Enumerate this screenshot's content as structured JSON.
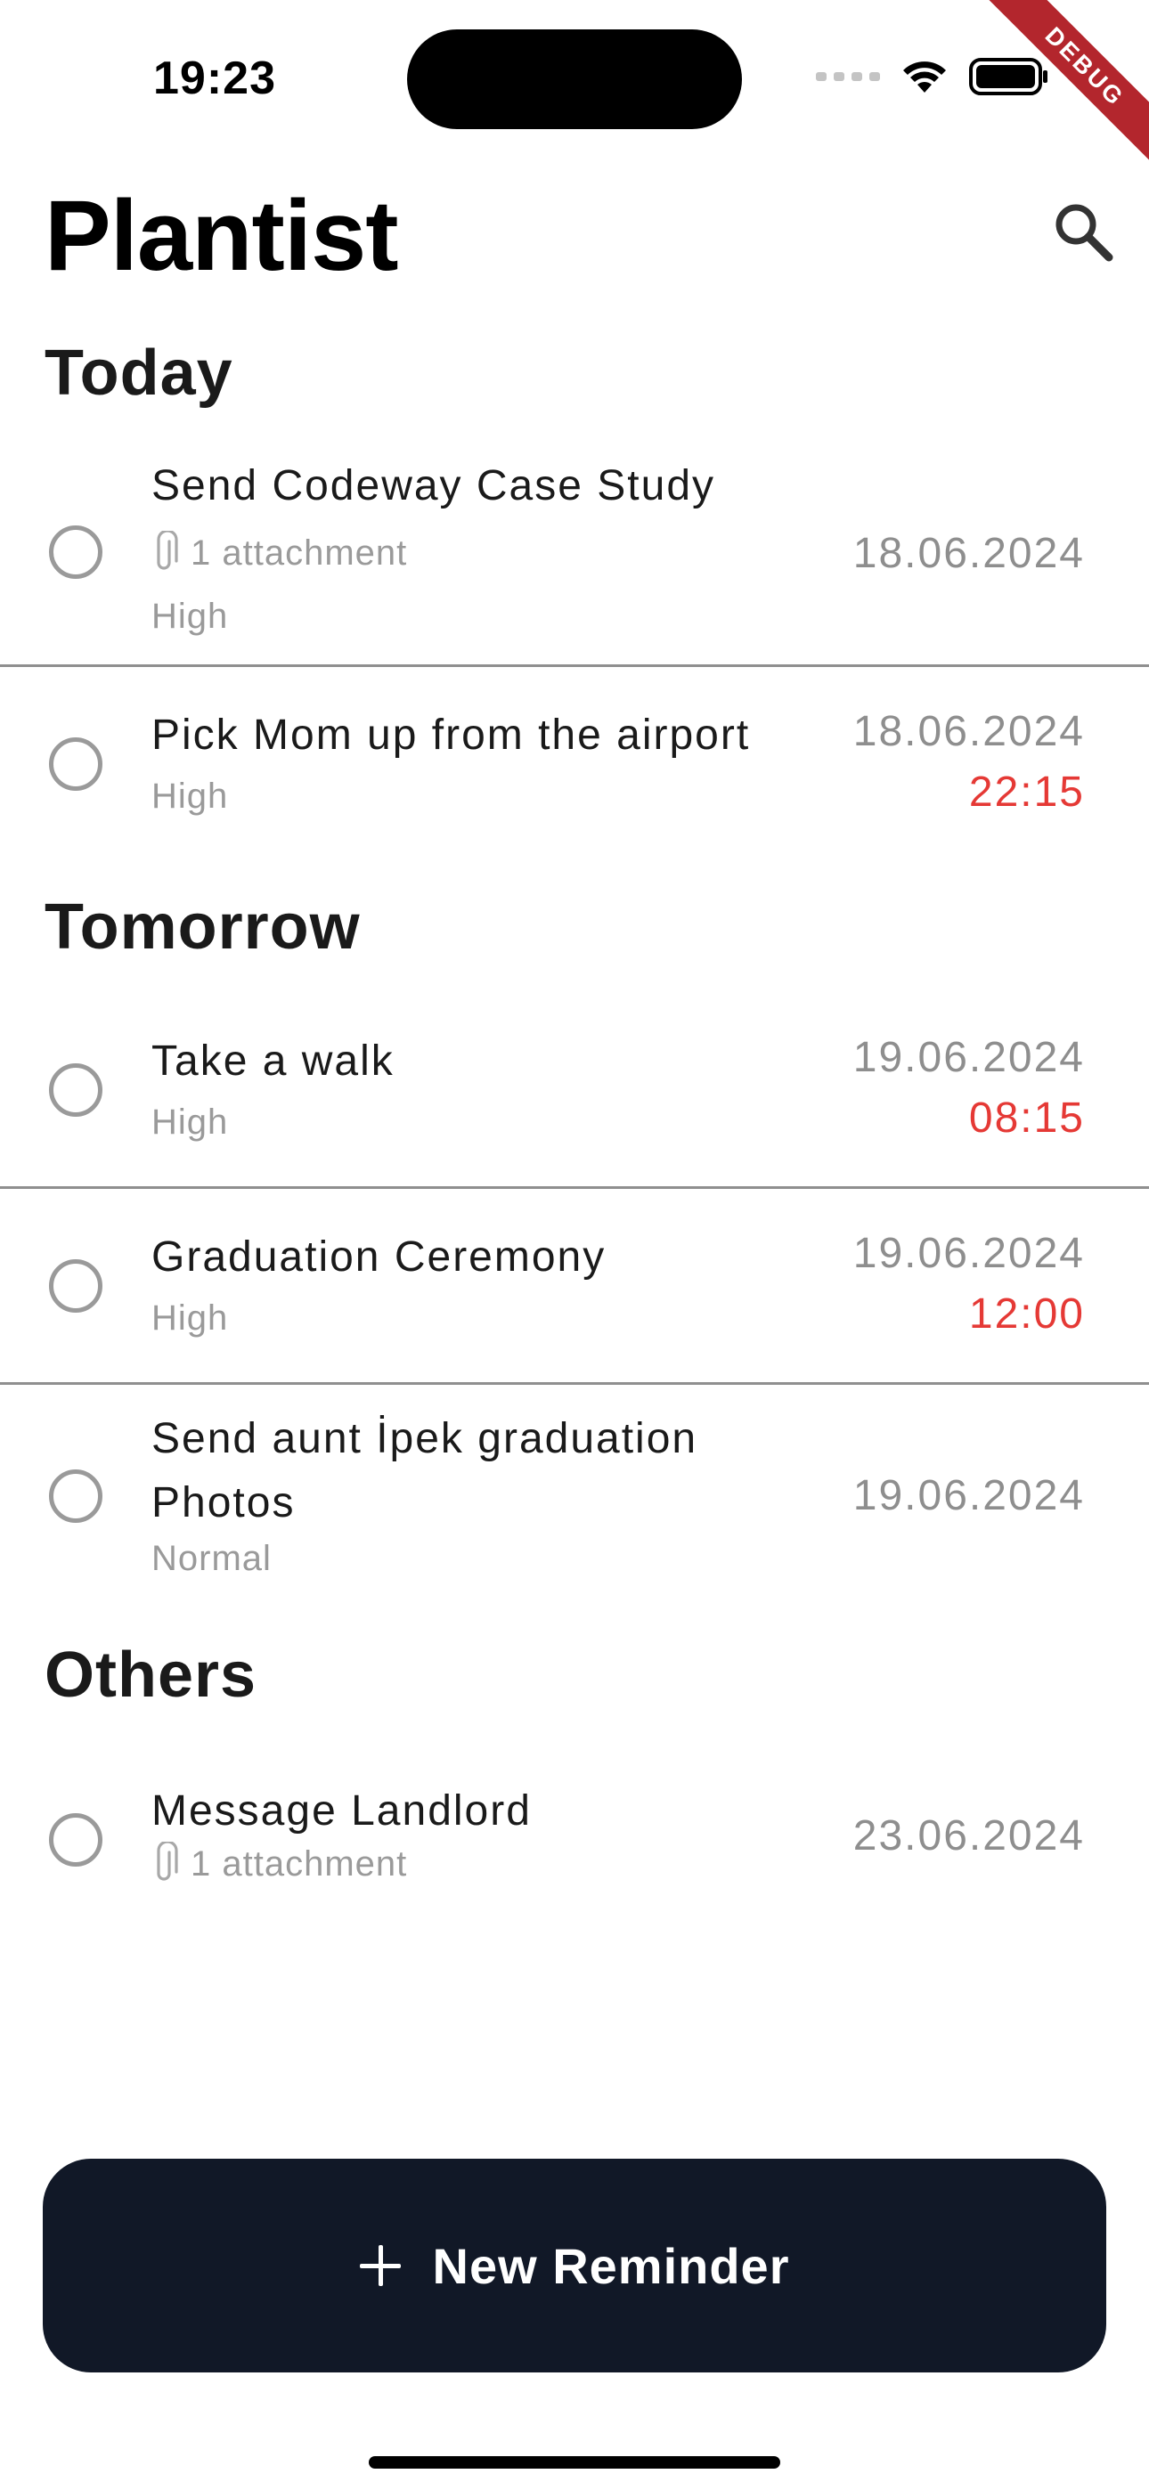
{
  "status_bar": {
    "time": "19:23"
  },
  "debug_banner": "DEBUG",
  "header": {
    "title": "Plantist",
    "search_icon": "search-icon"
  },
  "sections": [
    {
      "title": "Today",
      "items": [
        {
          "title": "Send Codeway Case Study",
          "attachment": "1 attachment",
          "priority": "High",
          "date": "18.06.2024",
          "time": ""
        },
        {
          "title": "Pick Mom up from the airport",
          "attachment": "",
          "priority": "High",
          "date": "18.06.2024",
          "time": "22:15"
        }
      ]
    },
    {
      "title": "Tomorrow",
      "items": [
        {
          "title": "Take a walk",
          "attachment": "",
          "priority": "High",
          "date": "19.06.2024",
          "time": "08:15"
        },
        {
          "title": "Graduation Ceremony",
          "attachment": "",
          "priority": "High",
          "date": "19.06.2024",
          "time": "12:00"
        },
        {
          "title_line1": "Send aunt İpek graduation",
          "title_line2": "Photos",
          "attachment": "",
          "priority": "Normal",
          "date": "19.06.2024",
          "time": ""
        }
      ]
    },
    {
      "title": "Others",
      "items": [
        {
          "title": "Message Landlord",
          "attachment": "1 attachment",
          "priority": "",
          "date": "23.06.2024",
          "time": ""
        }
      ]
    }
  ],
  "new_reminder_button": {
    "label": "New Reminder"
  },
  "colors": {
    "button_bg": "#111827",
    "overdue_time": "#e53935",
    "muted": "#9a9a9a",
    "debug": "#b3262d"
  }
}
